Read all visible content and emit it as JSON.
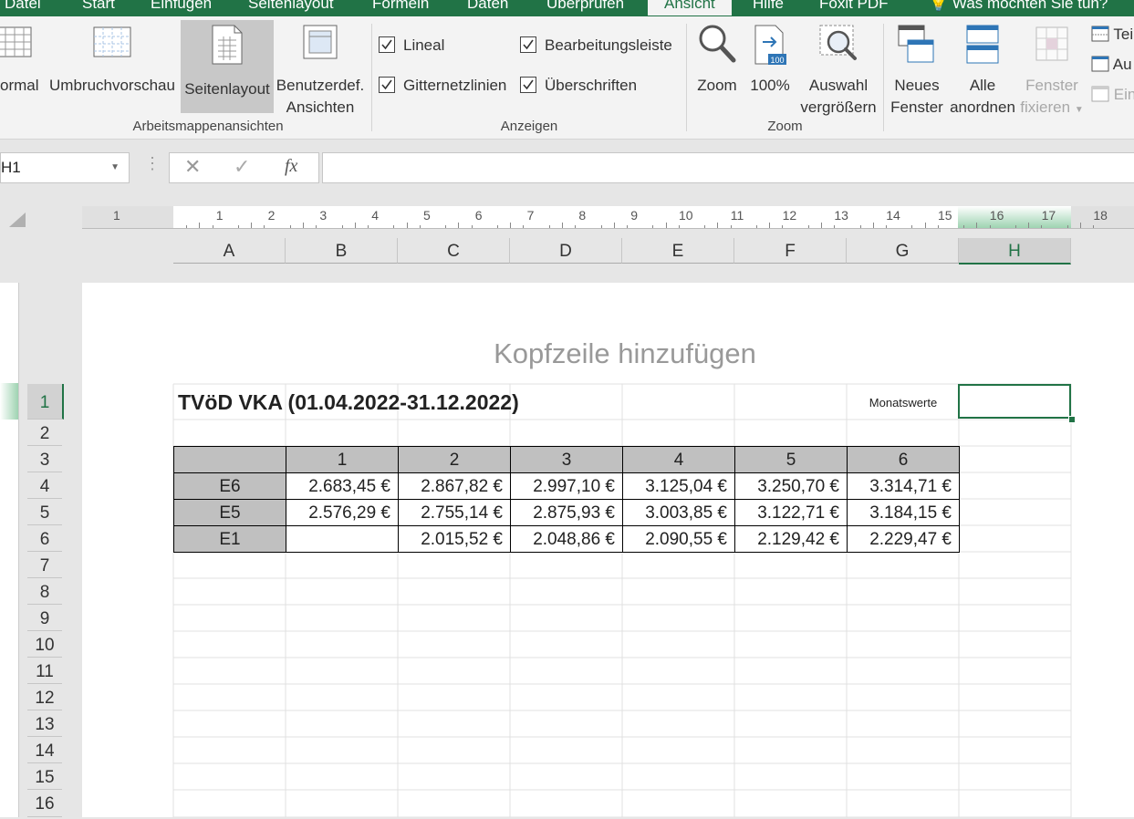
{
  "tabs": [
    "Datei",
    "Start",
    "Einfügen",
    "Seitenlayout",
    "Formeln",
    "Daten",
    "Überprüfen",
    "Ansicht",
    "Hilfe",
    "Foxit PDF",
    "Was möchten Sie tun?"
  ],
  "ribbon": {
    "views": {
      "normal": "ormal",
      "page_break": "Umbruchvorschau",
      "page_layout": "Seitenlayout",
      "custom_line1": "Benutzerdef.",
      "custom_line2": "Ansichten",
      "group_label": "Arbeitsmappenansichten"
    },
    "show": {
      "ruler": "Lineal",
      "formula_bar": "Bearbeitungsleiste",
      "gridlines": "Gitternetzlinien",
      "headings": "Überschriften",
      "group_label": "Anzeigen"
    },
    "zoom": {
      "zoom": "Zoom",
      "hundred": "100%",
      "hundred_badge": "100",
      "selection_line1": "Auswahl",
      "selection_line2": "vergrößern",
      "group_label": "Zoom"
    },
    "window": {
      "new_line1": "Neues",
      "new_line2": "Fenster",
      "arrange_line1": "Alle",
      "arrange_line2": "anordnen",
      "freeze_line1": "Fenster",
      "freeze_line2": "fixieren",
      "split": "Teil",
      "hide": "Au",
      "unhide": "Ein"
    }
  },
  "formula_bar": {
    "name_box": "H1",
    "cancel": "✕",
    "enter": "✓",
    "fx": "fx",
    "value": ""
  },
  "ruler": {
    "left_number": "1",
    "numbers": [
      "1",
      "2",
      "3",
      "4",
      "5",
      "6",
      "7",
      "8",
      "9",
      "10",
      "11",
      "12",
      "13",
      "14",
      "15",
      "16",
      "17",
      "18"
    ]
  },
  "columns": [
    "A",
    "B",
    "C",
    "D",
    "E",
    "F",
    "G",
    "H"
  ],
  "selected_column": "H",
  "rows": [
    "1",
    "2",
    "3",
    "4",
    "5",
    "6",
    "7",
    "8",
    "9",
    "10",
    "11",
    "12",
    "13",
    "14",
    "15",
    "16"
  ],
  "selected_row": "1",
  "page": {
    "header_placeholder": "Kopfzeile hinzufügen",
    "title": "TVöD VKA (01.04.2022-31.12.2022)",
    "monatswerte": "Monatswerte"
  },
  "table": {
    "stufen": [
      "1",
      "2",
      "3",
      "4",
      "5",
      "6"
    ],
    "rows": [
      {
        "group": "E6",
        "values": [
          "2.683,45 €",
          "2.867,82 €",
          "2.997,10 €",
          "3.125,04 €",
          "3.250,70 €",
          "3.314,71 €"
        ]
      },
      {
        "group": "E5",
        "values": [
          "2.576,29 €",
          "2.755,14 €",
          "2.875,93 €",
          "3.003,85 €",
          "3.122,71 €",
          "3.184,15 €"
        ]
      },
      {
        "group": "E1",
        "values": [
          "",
          "2.015,52 €",
          "2.048,86 €",
          "2.090,55 €",
          "2.129,42 €",
          "2.229,47 €"
        ]
      }
    ]
  },
  "colors": {
    "accent": "#217346",
    "table_header_fill": "#c0c0c0"
  }
}
